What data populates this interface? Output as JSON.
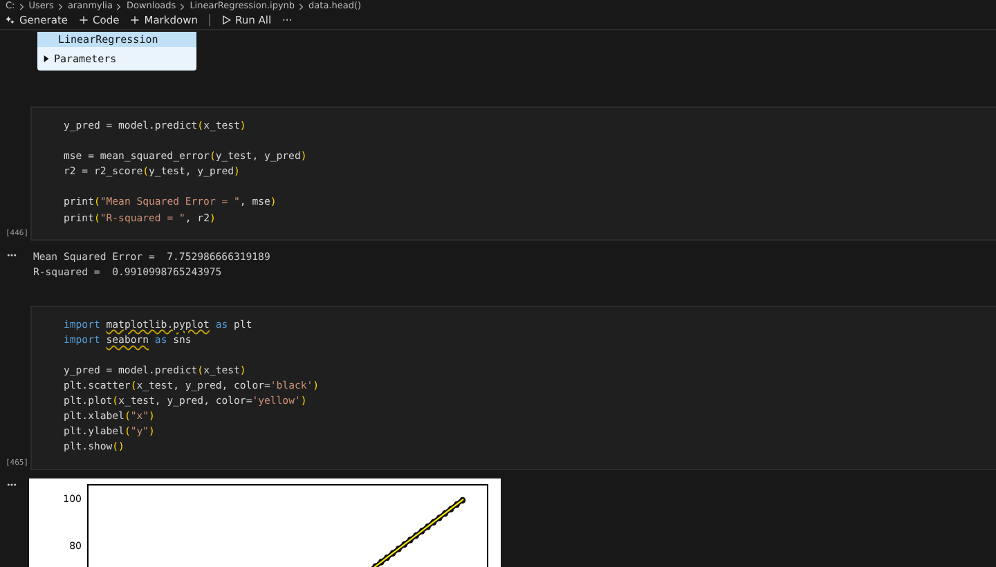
{
  "breadcrumb": [
    "C:",
    "Users",
    "aranmylia",
    "Downloads",
    "LinearRegression.ipynb",
    "data.head()"
  ],
  "toolbar": [
    {
      "label": "Generate"
    },
    {
      "label": "Code"
    },
    {
      "label": "Markdown"
    },
    {
      "label": "Run All"
    },
    {
      "label": "···"
    }
  ],
  "widget": {
    "title": "LinearRegression",
    "section": "Parameters"
  },
  "cells": [
    {
      "count": "[446]",
      "blocks": [
        [
          [
            {
              "text": "y_pred = model.predict",
              "kind": "t"
            },
            {
              "text": "(",
              "kind": "p"
            },
            {
              "text": "x_test",
              "kind": "t"
            },
            {
              "text": ")",
              "kind": "p"
            }
          ]
        ],
        [
          [
            {
              "text": "mse = mean_squared_error",
              "kind": "t"
            },
            {
              "text": "(",
              "kind": "p"
            },
            {
              "text": "y_test, y_pred",
              "kind": "t"
            },
            {
              "text": ")",
              "kind": "p"
            }
          ],
          [
            {
              "text": "r2 = r2_score",
              "kind": "t"
            },
            {
              "text": "(",
              "kind": "p"
            },
            {
              "text": "y_test, y_pred",
              "kind": "t"
            },
            {
              "text": ")",
              "kind": "p"
            }
          ]
        ],
        [
          [
            {
              "text": "print",
              "kind": "t"
            },
            {
              "text": "(",
              "kind": "p"
            },
            {
              "text": "\"Mean Squared Error = \"",
              "kind": "s"
            },
            {
              "text": ", mse",
              "kind": "t"
            },
            {
              "text": ")",
              "kind": "p"
            }
          ],
          [
            {
              "text": "print",
              "kind": "t"
            },
            {
              "text": "(",
              "kind": "p"
            },
            {
              "text": "\"R-squared = \"",
              "kind": "s"
            },
            {
              "text": ", r2",
              "kind": "t"
            },
            {
              "text": ")",
              "kind": "p"
            }
          ]
        ]
      ],
      "output": {
        "kind": "text",
        "lines": [
          "Mean Squared Error =  7.752986666319189",
          "R-squared =  0.9910998765243975"
        ]
      }
    },
    {
      "count": "[465]",
      "blocks": [
        [
          [
            {
              "text": "import ",
              "kind": "k"
            },
            {
              "text": "matplotlib.pyplot",
              "kind": "w"
            },
            {
              "text": " as ",
              "kind": "k"
            },
            {
              "text": "plt",
              "kind": "t"
            }
          ],
          [
            {
              "text": "import ",
              "kind": "k"
            },
            {
              "text": "seaborn",
              "kind": "w"
            },
            {
              "text": " as ",
              "kind": "k"
            },
            {
              "text": "sns",
              "kind": "t"
            }
          ]
        ],
        [
          [
            {
              "text": "y_pred = model.predict",
              "kind": "t"
            },
            {
              "text": "(",
              "kind": "p"
            },
            {
              "text": "x_test",
              "kind": "t"
            },
            {
              "text": ")",
              "kind": "p"
            }
          ],
          [
            {
              "text": "plt.scatter",
              "kind": "t"
            },
            {
              "text": "(",
              "kind": "p"
            },
            {
              "text": "x_test, y_pred, color=",
              "kind": "t"
            },
            {
              "text": "'black'",
              "kind": "s"
            },
            {
              "text": ")",
              "kind": "p"
            }
          ],
          [
            {
              "text": "plt.plot",
              "kind": "t"
            },
            {
              "text": "(",
              "kind": "p"
            },
            {
              "text": "x_test, y_pred, color=",
              "kind": "t"
            },
            {
              "text": "'yellow'",
              "kind": "s"
            },
            {
              "text": ")",
              "kind": "p"
            }
          ],
          [
            {
              "text": "plt.xlabel",
              "kind": "t"
            },
            {
              "text": "(",
              "kind": "p"
            },
            {
              "text": "\"x\"",
              "kind": "s"
            },
            {
              "text": ")",
              "kind": "p"
            }
          ],
          [
            {
              "text": "plt.ylabel",
              "kind": "t"
            },
            {
              "text": "(",
              "kind": "p"
            },
            {
              "text": "\"y\"",
              "kind": "s"
            },
            {
              "text": ")",
              "kind": "p"
            }
          ],
          [
            {
              "text": "plt.show",
              "kind": "t"
            },
            {
              "text": "()",
              "kind": "p"
            }
          ]
        ]
      ],
      "output": {
        "kind": "plot",
        "yticks": [
          "100",
          "80"
        ]
      }
    }
  ]
}
